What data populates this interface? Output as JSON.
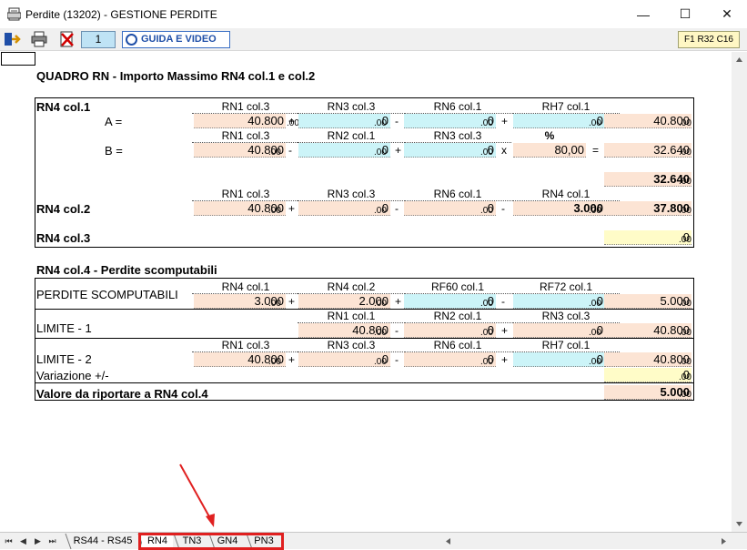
{
  "window": {
    "title": "Perdite (13202) - GESTIONE PERDITE",
    "minimize_glyph": "—",
    "maximize_glyph": "☐",
    "close_glyph": "✕"
  },
  "toolbar": {
    "page_number": "1",
    "guide_label": "GUIDA E VIDEO",
    "code_badge": "F1 R32 C16",
    "icons": [
      "exit-icon",
      "print-icon",
      "delete-icon",
      "help-icon"
    ]
  },
  "form": {
    "title": "QUADRO RN - Importo Massimo RN4 col.1 e col.2",
    "rn4col1": {
      "label": "RN4 col.1",
      "rowA": {
        "label": "A =",
        "heads": [
          "RN1 col.3",
          "RN3 col.3",
          "RN6 col.1",
          "RH7 col.1"
        ],
        "values": [
          "40.800",
          "0",
          "0",
          "0"
        ],
        "ops": [
          "+",
          "-",
          "+"
        ],
        "result": "40.800"
      },
      "rowB": {
        "label": "B =",
        "heads": [
          "RN1 col.3",
          "RN2 col.1",
          "RN3 col.3",
          "%"
        ],
        "values": [
          "40.800",
          "0",
          "0",
          "80,00"
        ],
        "ops": [
          "-",
          "+",
          "x",
          "="
        ],
        "result": "32.640"
      },
      "total": "32.640"
    },
    "rn4col2": {
      "label": "RN4 col.2",
      "heads": [
        "RN1 col.3",
        "RN3 col.3",
        "RN6 col.1",
        "RN4 col.1"
      ],
      "values": [
        "40.800",
        "0",
        "0",
        "3.000"
      ],
      "ops": [
        "+",
        "-",
        "-"
      ],
      "result": "37.800"
    },
    "rn4col3": {
      "label": "RN4 col.3",
      "value": "0"
    },
    "decimals": ".00",
    "perdite": {
      "title": "RN4 col.4 - Perdite scomputabili",
      "scomputabili": {
        "label": "PERDITE SCOMPUTABILI",
        "heads": [
          "RN4 col.1",
          "RN4 col.2",
          "RF60 col.1",
          "RF72 col.1"
        ],
        "values": [
          "3.000",
          "2.000",
          "0",
          "0"
        ],
        "ops": [
          "+",
          "+",
          "-"
        ],
        "result": "5.000"
      },
      "limite1": {
        "label": "LIMITE - 1",
        "heads": [
          "RN1 col.1",
          "RN2 col.1",
          "RN3 col.3"
        ],
        "values": [
          "40.800",
          "0",
          "0"
        ],
        "ops": [
          "-",
          "+"
        ],
        "result": "40.800"
      },
      "limite2": {
        "label": "LIMITE - 2",
        "heads": [
          "RN1 col.3",
          "RN3 col.3",
          "RN6 col.1",
          "RH7 col.1"
        ],
        "values": [
          "40.800",
          "0",
          "0",
          "0"
        ],
        "ops": [
          "+",
          "-",
          "+"
        ],
        "result": "40.800"
      },
      "variazione": {
        "label": "Variazione +/-",
        "value": "0"
      },
      "valore": {
        "label": "Valore da riportare a RN4 col.4",
        "value": "5.000"
      }
    }
  },
  "tabs": {
    "nav": [
      "⏮",
      "◀",
      "▶",
      "⏭"
    ],
    "items": [
      "RS44 - RS45",
      "RN4",
      "TN3",
      "GN4",
      "PN3"
    ],
    "active": "RN4"
  },
  "colors": {
    "peach": "#fce4d4",
    "cyan": "#ccf4f8",
    "yellow": "#fffcc8",
    "annotation_red": "#e02020"
  }
}
